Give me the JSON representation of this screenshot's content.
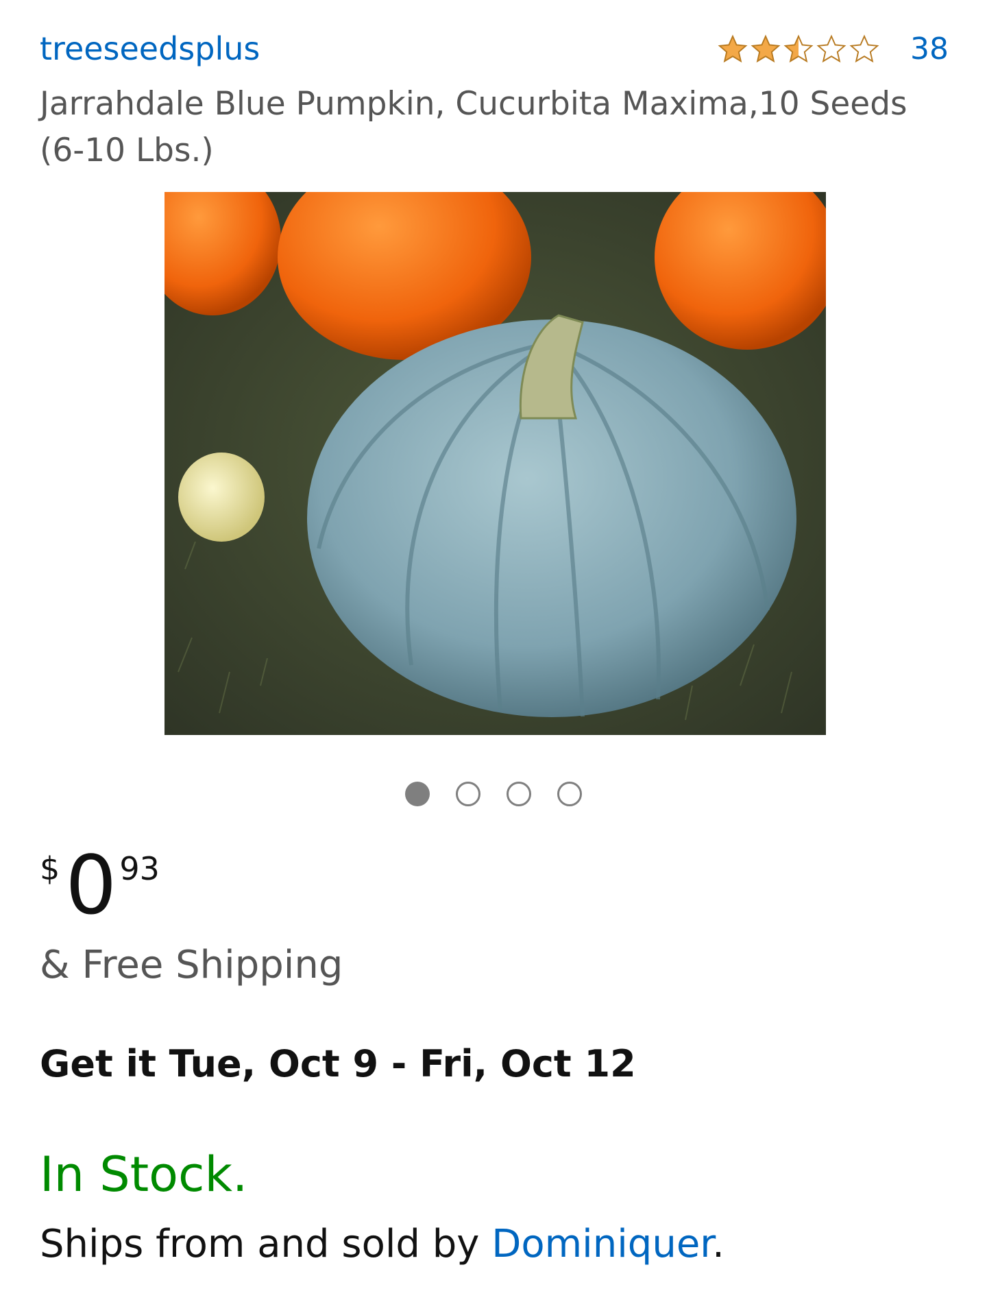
{
  "header": {
    "brand": "treeseedsplus",
    "rating": 2.5,
    "review_count": "38"
  },
  "product": {
    "title": "Jarrahdale Blue Pumpkin, Cucurbita Maxima,10 Seeds (6-10 Lbs.)"
  },
  "carousel": {
    "total": 4,
    "active_index": 0
  },
  "price": {
    "symbol": "$",
    "whole": "0",
    "fraction": "93"
  },
  "shipping": "& Free Shipping",
  "delivery": "Get it Tue, Oct 9 - Fri, Oct 12",
  "availability": "In Stock.",
  "seller": {
    "prefix": "Ships from and sold by ",
    "name": "Dominiquer",
    "suffix": "."
  },
  "colors": {
    "link": "#0066c0",
    "star": "#f3a847",
    "stock": "#008a00",
    "muted_text": "#555555"
  }
}
